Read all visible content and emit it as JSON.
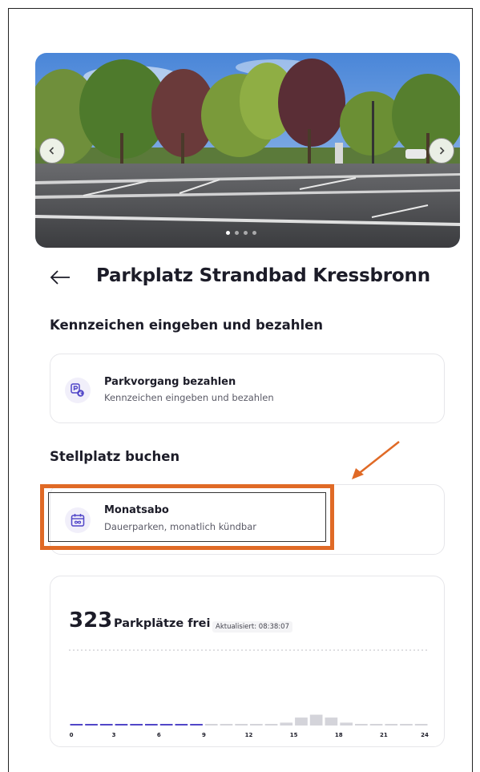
{
  "header": {
    "title": "Parkplatz Strandbad Kressbronn",
    "back_icon": "arrow-left-icon"
  },
  "gallery": {
    "prev_icon": "chevron-left-icon",
    "next_icon": "chevron-right-icon",
    "slide_count": 4,
    "active_slide": 1
  },
  "section_pay": {
    "title": "Kennzeichen eingeben und bezahlen",
    "option": {
      "title": "Parkvorgang bezahlen",
      "subtitle": "Kennzeichen eingeben und bezahlen",
      "icon": "parking-payment-icon"
    }
  },
  "section_book": {
    "title": "Stellplatz buchen",
    "option": {
      "title": "Monatsabo",
      "subtitle": "Dauerparken, monatlich kündbar",
      "icon": "calendar-infinity-icon"
    }
  },
  "availability": {
    "count": "323",
    "label": "Parkplätze frei",
    "updated": "Aktualisiert: 08:38:07"
  },
  "chart_data": {
    "type": "bar",
    "hours": [
      0,
      1,
      2,
      3,
      4,
      5,
      6,
      7,
      8,
      9,
      10,
      11,
      12,
      13,
      14,
      15,
      16,
      17,
      18,
      19,
      20,
      21,
      22,
      23
    ],
    "relative_occupancy": [
      0,
      0,
      0,
      0,
      0,
      0,
      0,
      0,
      0,
      0,
      0,
      0,
      0,
      0.05,
      0.2,
      0.55,
      0.75,
      0.55,
      0.2,
      0,
      0,
      0,
      0,
      0
    ],
    "past_hours": 9,
    "tick_labels": [
      "0",
      "3",
      "6",
      "9",
      "12",
      "15",
      "18",
      "21",
      "24"
    ],
    "colors": {
      "past": "#5146c8",
      "future": "#d4d4da"
    }
  },
  "colors": {
    "accent": "#5146c8",
    "annotation": "#e06a26"
  }
}
